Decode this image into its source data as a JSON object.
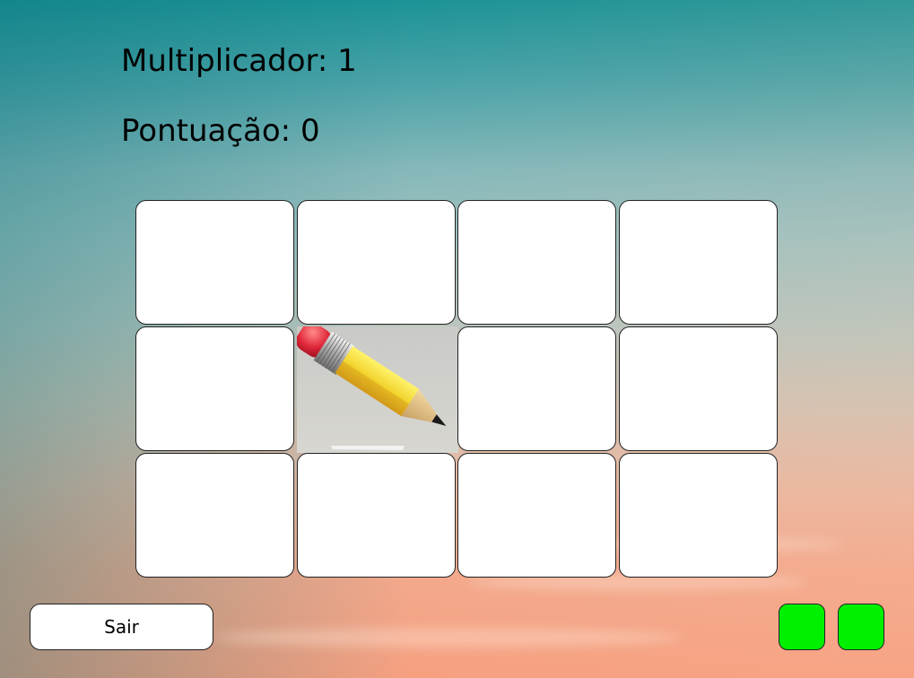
{
  "hud": {
    "multiplier_text": "Multiplicador: 1",
    "score_text": "Pontuação: 0"
  },
  "board": {
    "rows": 3,
    "cols": 4,
    "revealed_card": {
      "row": 2,
      "col": 2,
      "content": "pencil-icon"
    }
  },
  "controls": {
    "exit_label": "Sair",
    "green_buttons": 2,
    "green_color": "#00f100"
  }
}
